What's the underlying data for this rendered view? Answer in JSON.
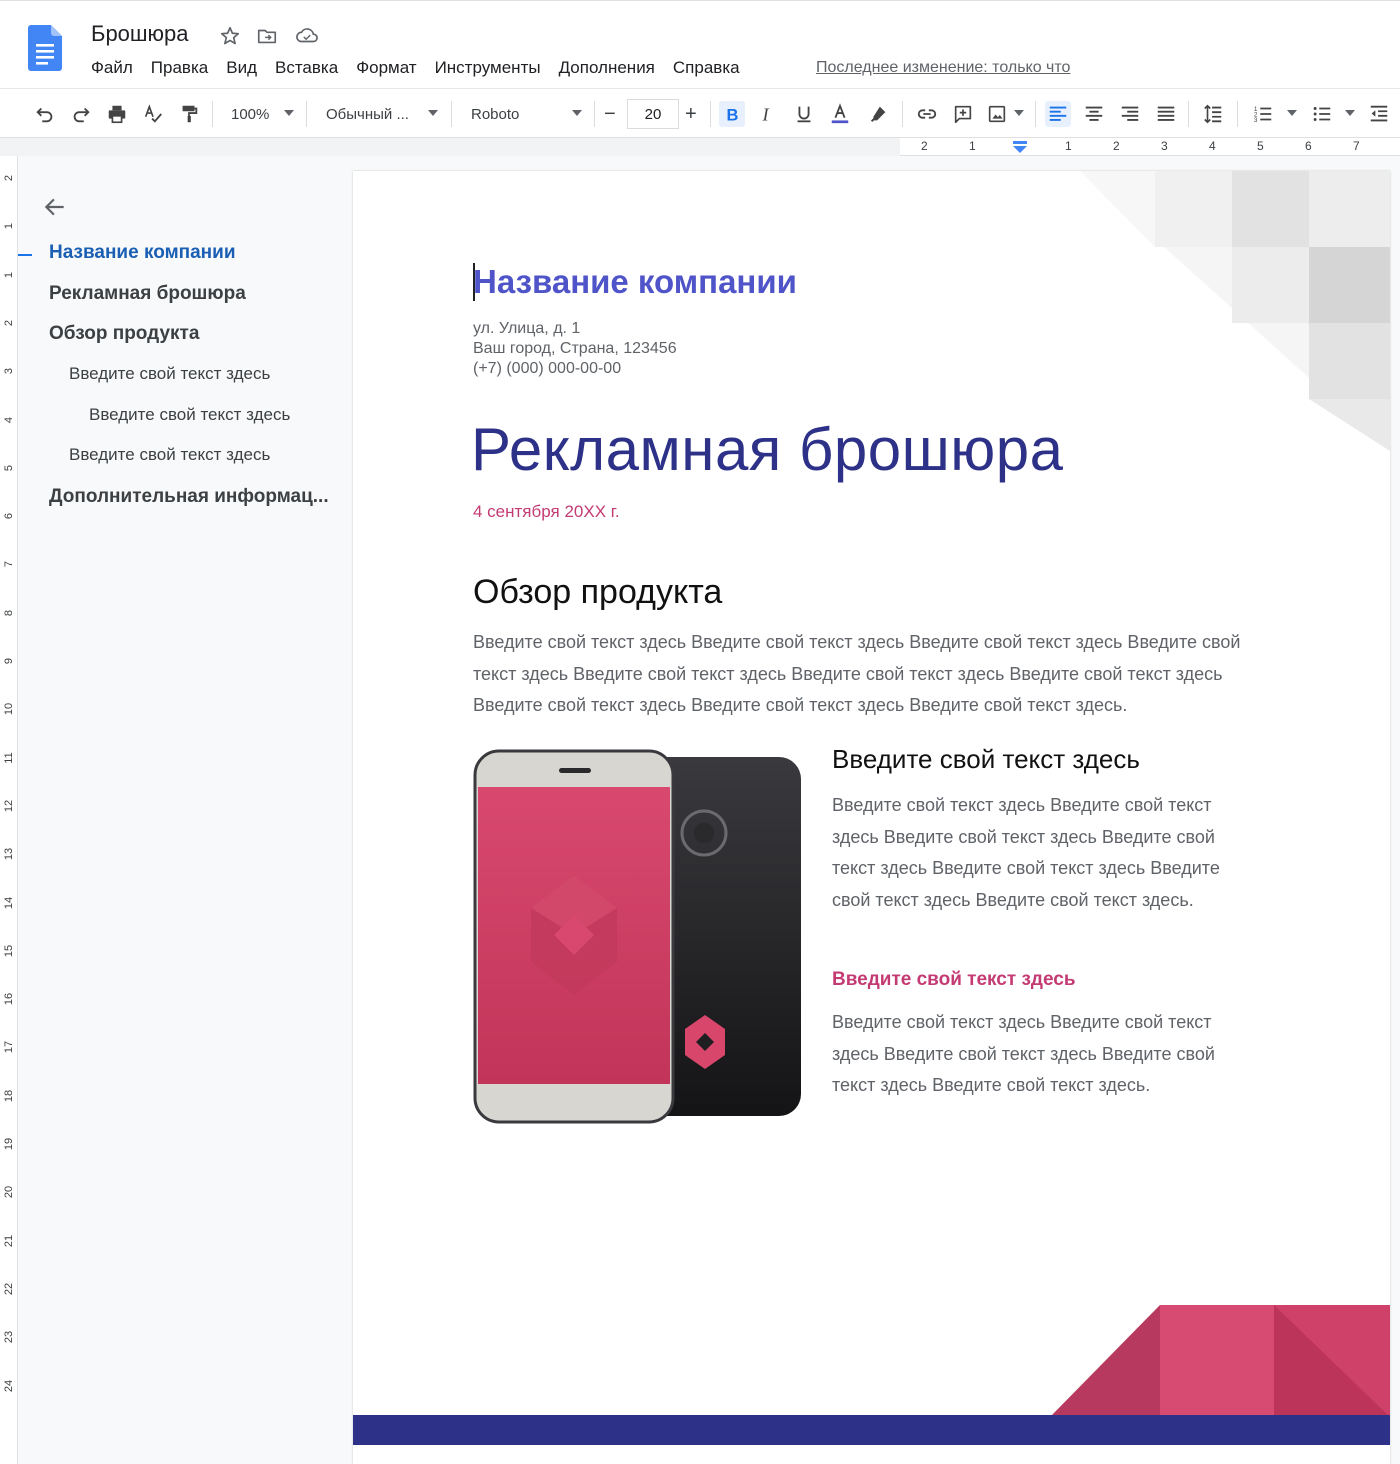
{
  "header": {
    "doc_title": "Брошюра",
    "menu": [
      "Файл",
      "Правка",
      "Вид",
      "Вставка",
      "Формат",
      "Инструменты",
      "Дополнения",
      "Справка"
    ],
    "last_edit": "Последнее изменение: только что"
  },
  "toolbar": {
    "zoom": "100%",
    "style": "Обычный ...",
    "font": "Roboto",
    "font_size": "20",
    "minus": "−",
    "plus": "+"
  },
  "ruler": {
    "h_ticks": [
      "2",
      "1",
      "1",
      "2",
      "3",
      "4",
      "5",
      "6",
      "7"
    ],
    "v_ticks": [
      "2",
      "1",
      "1",
      "2",
      "3",
      "4",
      "5",
      "6",
      "7",
      "8",
      "9",
      "10",
      "11",
      "12",
      "13",
      "14",
      "15",
      "16",
      "17",
      "18",
      "19",
      "20",
      "21",
      "22",
      "23",
      "24"
    ]
  },
  "outline": {
    "items": [
      {
        "label": "Название компании",
        "level": 1,
        "active": true
      },
      {
        "label": "Рекламная брошюра",
        "level": 1
      },
      {
        "label": "Обзор продукта",
        "level": 1
      },
      {
        "label": "Введите свой текст здесь",
        "level": 2
      },
      {
        "label": "Введите свой текст здесь",
        "level": 3
      },
      {
        "label": "Введите свой текст здесь",
        "level": 2
      },
      {
        "label": "Дополнительная информац...",
        "level": 1
      }
    ]
  },
  "page": {
    "company": "Название компании",
    "address_lines": [
      "ул. Улица, д. 1",
      "Ваш город, Страна, 123456",
      "(+7) (000) 000-00-00"
    ],
    "title": "Рекламная брошюра",
    "date": "4 сентября 20XX г.",
    "overview_heading": "Обзор продукта",
    "overview_text": "Введите свой текст здесь Введите свой текст здесь Введите свой текст здесь Введите свой текст здесь Введите свой текст здесь Введите свой текст здесь Введите свой текст здесь Введите свой текст здесь Введите свой текст здесь Введите свой текст здесь.",
    "sub1_heading": "Введите свой текст здесь",
    "sub1_text": "Введите свой текст здесь Введите свой текст здесь Введите свой текст здесь Введите свой текст здесь Введите свой текст здесь Введите свой текст здесь Введите свой текст здесь.",
    "sub2_heading": "Введите свой текст здесь",
    "sub2_text": "Введите свой текст здесь Введите свой текст здесь Введите свой текст здесь Введите свой текст здесь Введите свой текст здесь."
  },
  "colors": {
    "brand_blue": "#4285f4",
    "heading_purple": "#4f54c8",
    "title_navy": "#2d3187",
    "accent_pink": "#c43b74"
  }
}
